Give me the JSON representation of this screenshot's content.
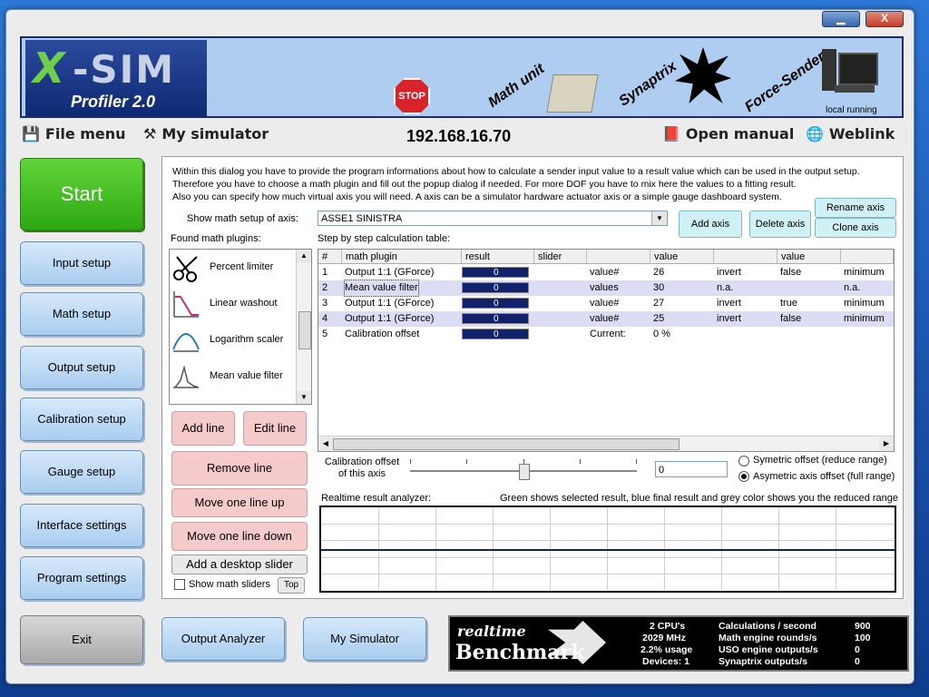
{
  "window": {
    "minimize_label": "▁",
    "close_label": "X"
  },
  "banner": {
    "logo_x": "X",
    "logo_sim": "-SIM",
    "logo_profiler": "Profiler 2.0",
    "stop_sign": "STOP",
    "math_unit": "Math unit",
    "synaptrix": "Synaptrix",
    "force_sender": "Force-Sender",
    "local_running": "local running"
  },
  "menu": {
    "file_menu": "File menu",
    "my_simulator": "My simulator",
    "ip": "192.168.16.70",
    "open_manual": "Open manual",
    "weblink": "Weblink"
  },
  "nav": {
    "start": "Start",
    "input_setup": "Input setup",
    "math_setup": "Math setup",
    "output_setup": "Output setup",
    "calibration_setup": "Calibration setup",
    "gauge_setup": "Gauge setup",
    "interface_settings": "Interface settings",
    "program_settings": "Program settings",
    "exit": "Exit",
    "output_analyzer": "Output Analyzer",
    "my_simulator_btn": "My Simulator"
  },
  "intro": {
    "line1": "Within this dialog you have to provide the program informations about how to calculate a sender input value to a result value which can be used in the output setup.",
    "line2": "Therefore you have to choose a math plugin and fill out the popup dialog if needed. For more DOF you have to mix here the values to a fitting result.",
    "line3": "Also you can specify how much virtual axis you will need. A axis can be a simulator hardware actuator axis or a simple gauge dashboard system."
  },
  "axis": {
    "label": "Show math setup of axis:",
    "value": "ASSE1 SINISTRA",
    "add": "Add axis",
    "delete": "Delete axis",
    "rename": "Rename axis",
    "clone": "Clone axis"
  },
  "plugins": {
    "label": "Found math plugins:",
    "items": [
      {
        "name": "Percent limiter",
        "icon": "scissors-icon"
      },
      {
        "name": "Linear washout",
        "icon": "washout-graph-icon"
      },
      {
        "name": "Logarithm scaler",
        "icon": "log-curve-icon"
      },
      {
        "name": "Mean value filter",
        "icon": "filter-graph-icon"
      }
    ]
  },
  "buttons": {
    "add_line": "Add line",
    "edit_line": "Edit line",
    "remove_line": "Remove line",
    "move_up": "Move one line up",
    "move_down": "Move one line down",
    "desktop_slider": "Add a desktop slider",
    "show_math_sliders": "Show math sliders",
    "top": "Top"
  },
  "table": {
    "label": "Step by step calculation table:",
    "headers": [
      "#",
      "math plugin",
      "result",
      "slider",
      "",
      "value",
      "",
      "value",
      ""
    ],
    "rows": [
      {
        "n": "1",
        "plugin": "Output 1:1 (GForce)",
        "result": "0",
        "c1": "value#",
        "c2": "26",
        "c3": "invert",
        "c4": "false",
        "c5": "minimum"
      },
      {
        "n": "2",
        "plugin": "Mean value filter",
        "result": "0",
        "c1": "values",
        "c2": "30",
        "c3": "n.a.",
        "c4": "",
        "c5": "n.a."
      },
      {
        "n": "3",
        "plugin": "Output 1:1 (GForce)",
        "result": "0",
        "c1": "value#",
        "c2": "27",
        "c3": "invert",
        "c4": "true",
        "c5": "minimum"
      },
      {
        "n": "4",
        "plugin": "Output 1:1 (GForce)",
        "result": "0",
        "c1": "value#",
        "c2": "25",
        "c3": "invert",
        "c4": "false",
        "c5": "minimum"
      },
      {
        "n": "5",
        "plugin": "Calibration offset",
        "result": "0",
        "c1": "Current:",
        "c2": "0 %",
        "c3": "",
        "c4": "",
        "c5": ""
      }
    ]
  },
  "calibration": {
    "label": "Calibration offset\nof this axis",
    "value": "0",
    "slider_level": 0.5,
    "option_symmetric": "Symetric offset (reduce range)",
    "option_asymmetric": "Asymetric axis offset (full range)",
    "selected": "asymmetric"
  },
  "analyzer": {
    "label": "Realtime result analyzer:",
    "hint": "Green shows selected result, blue final result and grey color shows you the reduced range"
  },
  "benchmark": {
    "logo_top": "realtime",
    "logo_bottom": "Benchmark",
    "cpus": "2 CPU's",
    "mhz": "2029 MHz",
    "usage": "2.2% usage",
    "devices": "Devices: 1",
    "calc_label": "Calculations / second",
    "calc_value": "900",
    "rounds_label": "Math engine rounds/s",
    "rounds_value": "100",
    "uso_label": "USO engine outputs/s",
    "uso_value": "0",
    "syn_label": "Synaptrix outputs/s",
    "syn_value": "0"
  }
}
